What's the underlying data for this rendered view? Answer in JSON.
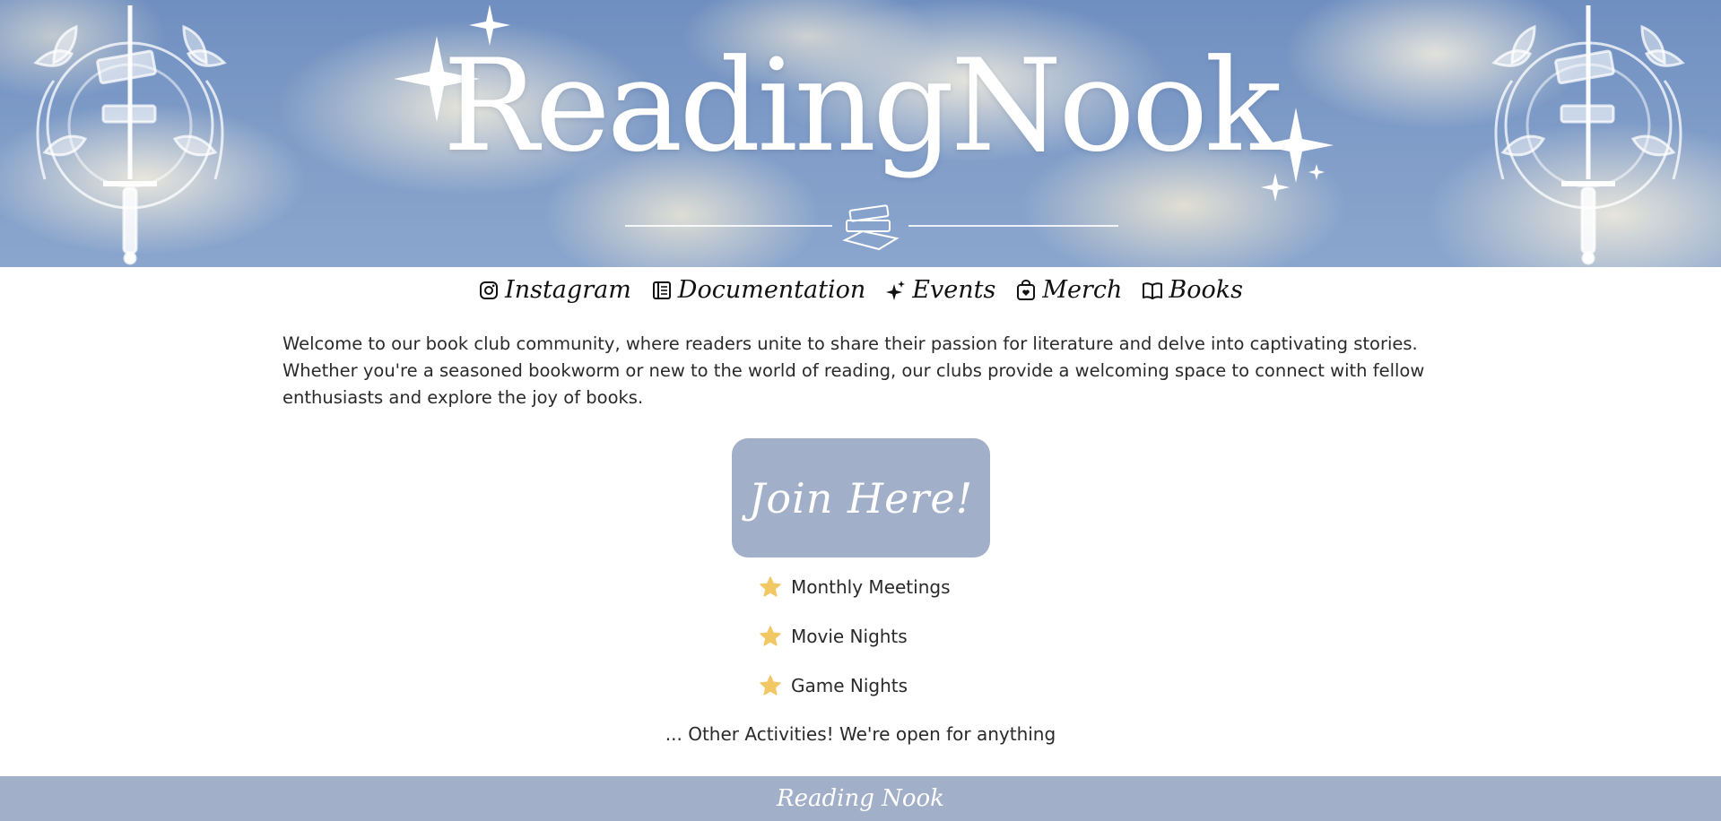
{
  "banner": {
    "title": "ReadingNook"
  },
  "nav": {
    "items": [
      {
        "label": "Instagram",
        "icon": "instagram-icon"
      },
      {
        "label": "Documentation",
        "icon": "document-icon"
      },
      {
        "label": "Events",
        "icon": "sparkles-icon"
      },
      {
        "label": "Merch",
        "icon": "shopping-bag-icon"
      },
      {
        "label": "Books",
        "icon": "open-book-icon"
      }
    ]
  },
  "intro": {
    "text": "Welcome to our book club community, where readers unite to share their passion for literature and delve into captivating stories. Whether you're a seasoned bookworm or new to the world of reading, our clubs provide a welcoming space to connect with fellow enthusiasts and explore the joy of books."
  },
  "join": {
    "label": "Join Here!"
  },
  "activities": {
    "items": [
      {
        "label": "Monthly Meetings",
        "icon": "star-icon"
      },
      {
        "label": "Movie Nights",
        "icon": "star-icon"
      },
      {
        "label": "Game Nights",
        "icon": "star-icon"
      }
    ],
    "other": "... Other Activities! We're open for anything"
  },
  "footer": {
    "label": "Reading Nook"
  },
  "colors": {
    "accent": "#a2afc8",
    "star": "#f2c865",
    "sky": "#7f9cc8"
  }
}
